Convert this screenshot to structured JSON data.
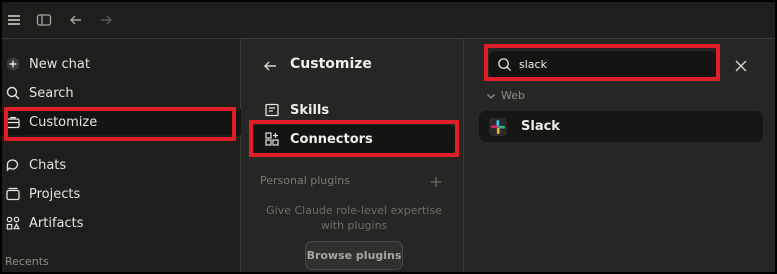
{
  "sidebar": {
    "items": [
      {
        "label": "New chat",
        "icon": "plus-circle-icon"
      },
      {
        "label": "Search",
        "icon": "search-icon"
      },
      {
        "label": "Customize",
        "icon": "briefcase-icon"
      },
      {
        "label": "Chats",
        "icon": "chat-bubbles-icon"
      },
      {
        "label": "Projects",
        "icon": "folder-icon"
      },
      {
        "label": "Artifacts",
        "icon": "artifacts-icon"
      }
    ],
    "recents_label": "Recents"
  },
  "customize_panel": {
    "title": "Customize",
    "items": [
      {
        "label": "Skills",
        "icon": "skills-icon"
      },
      {
        "label": "Connectors",
        "icon": "connectors-icon"
      }
    ],
    "section_label": "Personal plugins",
    "empty_text": "Give Claude role-level expertise with plugins",
    "browse_button": "Browse plugins"
  },
  "connectors_panel": {
    "search": {
      "value": "slack",
      "placeholder": ""
    },
    "section": "Web",
    "results": [
      {
        "label": "Slack",
        "icon": "slack-logo-icon"
      }
    ]
  },
  "colors": {
    "highlight": "#e01e29",
    "sidebar_bg": "#1f1e1d",
    "panel_bg": "#262624",
    "active_bg": "#141413"
  }
}
